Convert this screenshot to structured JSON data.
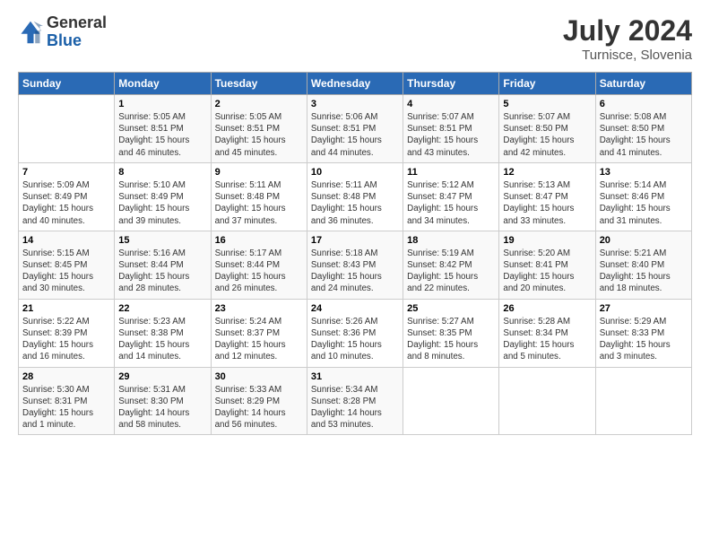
{
  "logo": {
    "general": "General",
    "blue": "Blue"
  },
  "title": "July 2024",
  "subtitle": "Turnisce, Slovenia",
  "days_of_week": [
    "Sunday",
    "Monday",
    "Tuesday",
    "Wednesday",
    "Thursday",
    "Friday",
    "Saturday"
  ],
  "weeks": [
    [
      {
        "day": "",
        "info": ""
      },
      {
        "day": "1",
        "info": "Sunrise: 5:05 AM\nSunset: 8:51 PM\nDaylight: 15 hours\nand 46 minutes."
      },
      {
        "day": "2",
        "info": "Sunrise: 5:05 AM\nSunset: 8:51 PM\nDaylight: 15 hours\nand 45 minutes."
      },
      {
        "day": "3",
        "info": "Sunrise: 5:06 AM\nSunset: 8:51 PM\nDaylight: 15 hours\nand 44 minutes."
      },
      {
        "day": "4",
        "info": "Sunrise: 5:07 AM\nSunset: 8:51 PM\nDaylight: 15 hours\nand 43 minutes."
      },
      {
        "day": "5",
        "info": "Sunrise: 5:07 AM\nSunset: 8:50 PM\nDaylight: 15 hours\nand 42 minutes."
      },
      {
        "day": "6",
        "info": "Sunrise: 5:08 AM\nSunset: 8:50 PM\nDaylight: 15 hours\nand 41 minutes."
      }
    ],
    [
      {
        "day": "7",
        "info": "Sunrise: 5:09 AM\nSunset: 8:49 PM\nDaylight: 15 hours\nand 40 minutes."
      },
      {
        "day": "8",
        "info": "Sunrise: 5:10 AM\nSunset: 8:49 PM\nDaylight: 15 hours\nand 39 minutes."
      },
      {
        "day": "9",
        "info": "Sunrise: 5:11 AM\nSunset: 8:48 PM\nDaylight: 15 hours\nand 37 minutes."
      },
      {
        "day": "10",
        "info": "Sunrise: 5:11 AM\nSunset: 8:48 PM\nDaylight: 15 hours\nand 36 minutes."
      },
      {
        "day": "11",
        "info": "Sunrise: 5:12 AM\nSunset: 8:47 PM\nDaylight: 15 hours\nand 34 minutes."
      },
      {
        "day": "12",
        "info": "Sunrise: 5:13 AM\nSunset: 8:47 PM\nDaylight: 15 hours\nand 33 minutes."
      },
      {
        "day": "13",
        "info": "Sunrise: 5:14 AM\nSunset: 8:46 PM\nDaylight: 15 hours\nand 31 minutes."
      }
    ],
    [
      {
        "day": "14",
        "info": "Sunrise: 5:15 AM\nSunset: 8:45 PM\nDaylight: 15 hours\nand 30 minutes."
      },
      {
        "day": "15",
        "info": "Sunrise: 5:16 AM\nSunset: 8:44 PM\nDaylight: 15 hours\nand 28 minutes."
      },
      {
        "day": "16",
        "info": "Sunrise: 5:17 AM\nSunset: 8:44 PM\nDaylight: 15 hours\nand 26 minutes."
      },
      {
        "day": "17",
        "info": "Sunrise: 5:18 AM\nSunset: 8:43 PM\nDaylight: 15 hours\nand 24 minutes."
      },
      {
        "day": "18",
        "info": "Sunrise: 5:19 AM\nSunset: 8:42 PM\nDaylight: 15 hours\nand 22 minutes."
      },
      {
        "day": "19",
        "info": "Sunrise: 5:20 AM\nSunset: 8:41 PM\nDaylight: 15 hours\nand 20 minutes."
      },
      {
        "day": "20",
        "info": "Sunrise: 5:21 AM\nSunset: 8:40 PM\nDaylight: 15 hours\nand 18 minutes."
      }
    ],
    [
      {
        "day": "21",
        "info": "Sunrise: 5:22 AM\nSunset: 8:39 PM\nDaylight: 15 hours\nand 16 minutes."
      },
      {
        "day": "22",
        "info": "Sunrise: 5:23 AM\nSunset: 8:38 PM\nDaylight: 15 hours\nand 14 minutes."
      },
      {
        "day": "23",
        "info": "Sunrise: 5:24 AM\nSunset: 8:37 PM\nDaylight: 15 hours\nand 12 minutes."
      },
      {
        "day": "24",
        "info": "Sunrise: 5:26 AM\nSunset: 8:36 PM\nDaylight: 15 hours\nand 10 minutes."
      },
      {
        "day": "25",
        "info": "Sunrise: 5:27 AM\nSunset: 8:35 PM\nDaylight: 15 hours\nand 8 minutes."
      },
      {
        "day": "26",
        "info": "Sunrise: 5:28 AM\nSunset: 8:34 PM\nDaylight: 15 hours\nand 5 minutes."
      },
      {
        "day": "27",
        "info": "Sunrise: 5:29 AM\nSunset: 8:33 PM\nDaylight: 15 hours\nand 3 minutes."
      }
    ],
    [
      {
        "day": "28",
        "info": "Sunrise: 5:30 AM\nSunset: 8:31 PM\nDaylight: 15 hours\nand 1 minute."
      },
      {
        "day": "29",
        "info": "Sunrise: 5:31 AM\nSunset: 8:30 PM\nDaylight: 14 hours\nand 58 minutes."
      },
      {
        "day": "30",
        "info": "Sunrise: 5:33 AM\nSunset: 8:29 PM\nDaylight: 14 hours\nand 56 minutes."
      },
      {
        "day": "31",
        "info": "Sunrise: 5:34 AM\nSunset: 8:28 PM\nDaylight: 14 hours\nand 53 minutes."
      },
      {
        "day": "",
        "info": ""
      },
      {
        "day": "",
        "info": ""
      },
      {
        "day": "",
        "info": ""
      }
    ]
  ]
}
